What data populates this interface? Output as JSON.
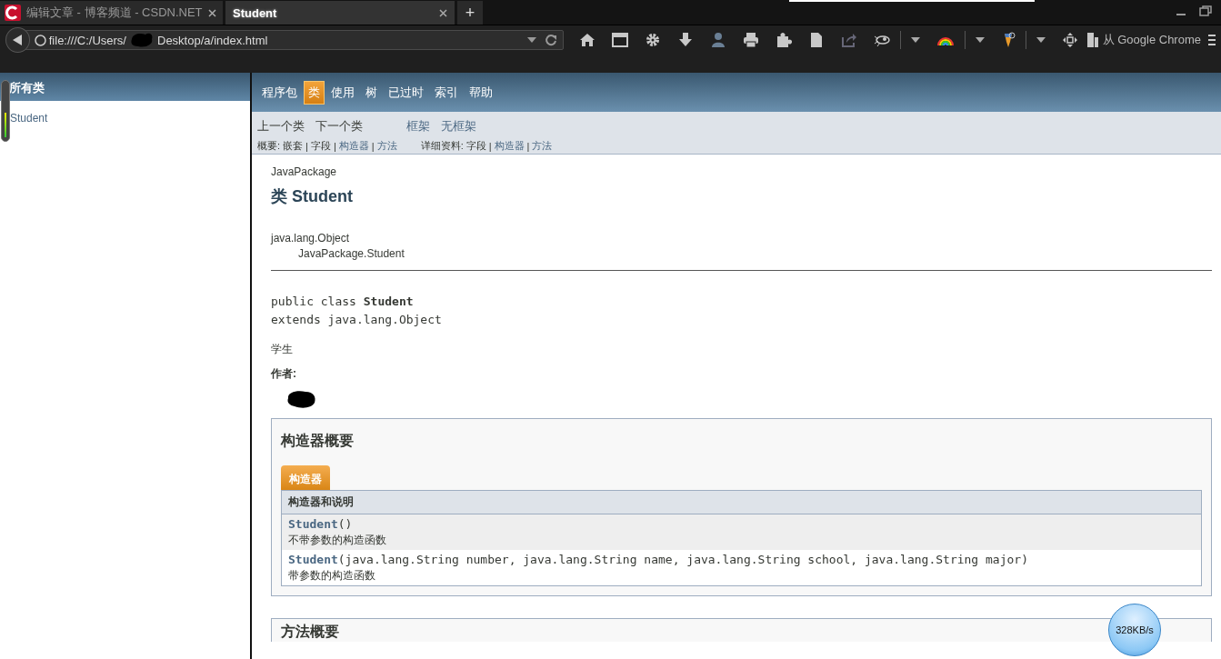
{
  "tabs": [
    {
      "title": "编辑文章 - 博客频道 - CSDN.NET",
      "selected": false
    },
    {
      "title": "Student",
      "selected": true
    }
  ],
  "new_tab": "+",
  "address_bar": {
    "url_start": "file:///C:/Users/",
    "url_end": "Desktop/a/index.html"
  },
  "toolbar": {
    "import_label": "从 Google Chrome"
  },
  "left_frame": {
    "title": "所有类",
    "classes": [
      "Student"
    ],
    "meter": {
      "level": 0.45
    }
  },
  "nav": {
    "items": [
      {
        "label": "程序包",
        "selected": false
      },
      {
        "label": "类",
        "selected": true
      },
      {
        "label": "使用",
        "selected": false
      },
      {
        "label": "树",
        "selected": false
      },
      {
        "label": "已过时",
        "selected": false
      },
      {
        "label": "索引",
        "selected": false
      },
      {
        "label": "帮助",
        "selected": false
      }
    ]
  },
  "subnav": {
    "class_links": [
      "上一个类",
      "下一个类"
    ],
    "frame_links": [
      "框架",
      "无框架"
    ],
    "separator": "|",
    "summary_label": "概要:",
    "summary": [
      {
        "label": "嵌套",
        "disabled": true
      },
      {
        "label": "字段",
        "disabled": true
      },
      {
        "label": "构造器",
        "disabled": false
      },
      {
        "label": "方法",
        "disabled": false
      }
    ],
    "detail_label": "详细资料:",
    "detail": [
      {
        "label": "字段",
        "disabled": true
      },
      {
        "label": "构造器",
        "disabled": false
      },
      {
        "label": "方法",
        "disabled": false
      }
    ]
  },
  "doc": {
    "package": "JavaPackage",
    "title": "类 Student",
    "inheritance": {
      "name": "java.lang.Object",
      "children": [
        {
          "name": "JavaPackage.Student"
        }
      ]
    },
    "signature": [
      "public class **Student**",
      "extends java.lang.Object"
    ],
    "description": "学生",
    "author_label": "作者:",
    "constructor_summary": {
      "title": "构造器概要",
      "tab": "构造器",
      "header": "构造器和说明",
      "rows": [
        {
          "name": "Student",
          "params": "()",
          "description": "不带参数的构造函数"
        },
        {
          "name": "Student",
          "params": "(java.lang.String number, java.lang.String name, java.lang.String school, java.lang.String major)",
          "description": "带参数的构造函数"
        }
      ]
    },
    "method_summary": {
      "title": "方法概要"
    }
  },
  "speed": "328KB/s"
}
